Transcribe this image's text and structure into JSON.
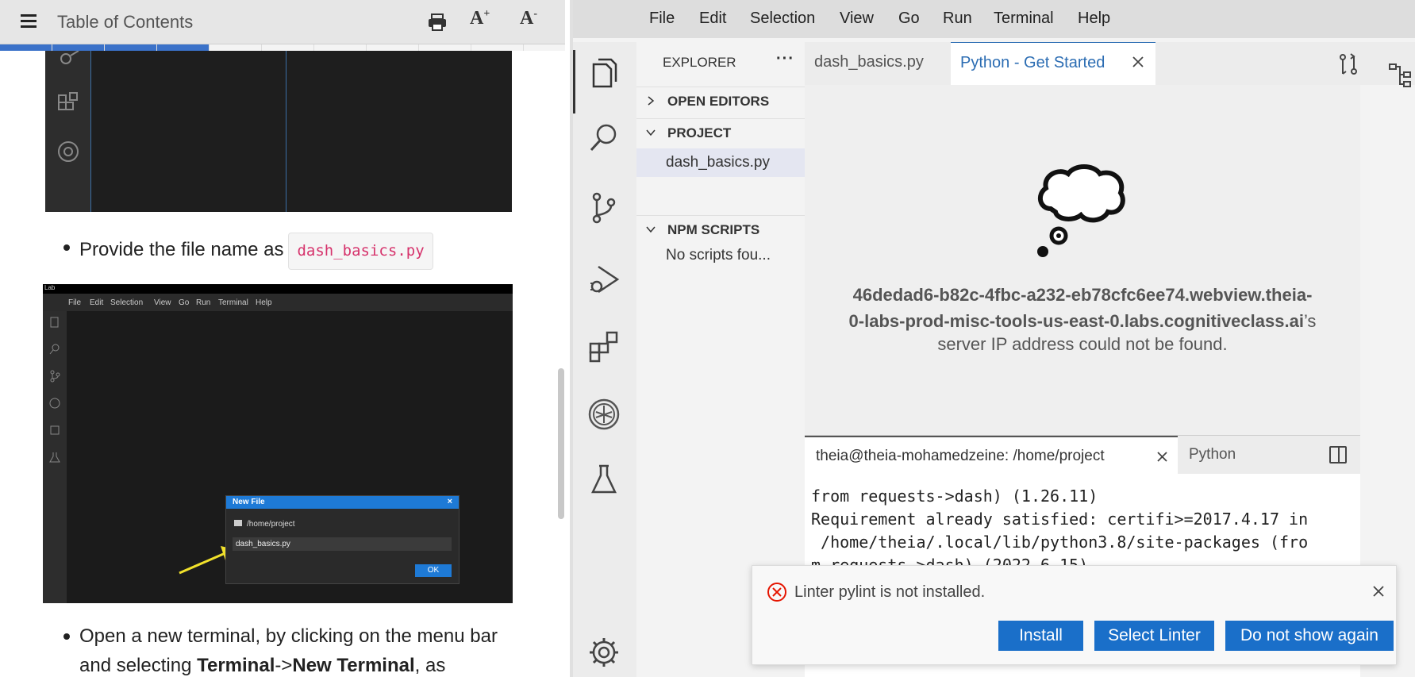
{
  "toc": {
    "title": "Table of Contents",
    "font_increase": "A",
    "font_increase_sup": "+",
    "font_decrease": "A",
    "font_decrease_sup": "-"
  },
  "instructions": {
    "bullet1_text": "Provide the file name as",
    "bullet1_code": "dash_basics.py",
    "bullet2_part1": "Open a new terminal, by clicking on the menu bar and selecting ",
    "bullet2_bold1": "Terminal",
    "bullet2_arrow": "->",
    "bullet2_bold2": "New Terminal",
    "bullet2_part2": ", as"
  },
  "screenshot2": {
    "topbar": "Lab",
    "menu": [
      "File",
      "Edit",
      "Selection",
      "View",
      "Go",
      "Run",
      "Terminal",
      "Help"
    ],
    "dialog_title": "New File",
    "dialog_close": "×",
    "dialog_path": "/home/project",
    "dialog_input": "dash_basics.py",
    "dialog_ok": "OK"
  },
  "ide": {
    "menu": [
      "File",
      "Edit",
      "Selection",
      "View",
      "Go",
      "Run",
      "Terminal",
      "Help"
    ],
    "explorer": {
      "title": "EXPLORER",
      "more": "···",
      "open_editors": "OPEN EDITORS",
      "project": "PROJECT",
      "file": "dash_basics.py",
      "npm_scripts": "NPM SCRIPTS",
      "npm_empty": "No scripts fou..."
    },
    "tabs": {
      "tab1": "dash_basics.py",
      "tab2": "Python - Get Started"
    },
    "webview_error": {
      "host_line1": "46dedad6-b82c-4fbc-a232-eb78cfc6ee74.webview.theia-",
      "host_line2": "0-labs-prod-misc-tools-us-east-0.labs.cognitiveclass.ai",
      "host_suffix": "’s",
      "message": "server IP address could not be found."
    },
    "terminal": {
      "tab1": "theia@theia-mohamedzeine: /home/project",
      "tab2": "Python",
      "lines": [
        "from requests->dash) (1.26.11)",
        "Requirement already satisfied: certifi>=2017.4.17 in",
        " /home/theia/.local/lib/python3.8/site-packages (fro",
        "m requests->dash) (2022.6.15)"
      ]
    },
    "notification": {
      "message": "Linter pylint is not installed.",
      "install": "Install",
      "select_linter": "Select Linter",
      "dont_show": "Do not show again"
    }
  },
  "colors": {
    "accent_blue": "#1a6fc9",
    "code_pink": "#d6336c",
    "error_red": "#e51400",
    "progress_blue": "#3b72c9"
  }
}
